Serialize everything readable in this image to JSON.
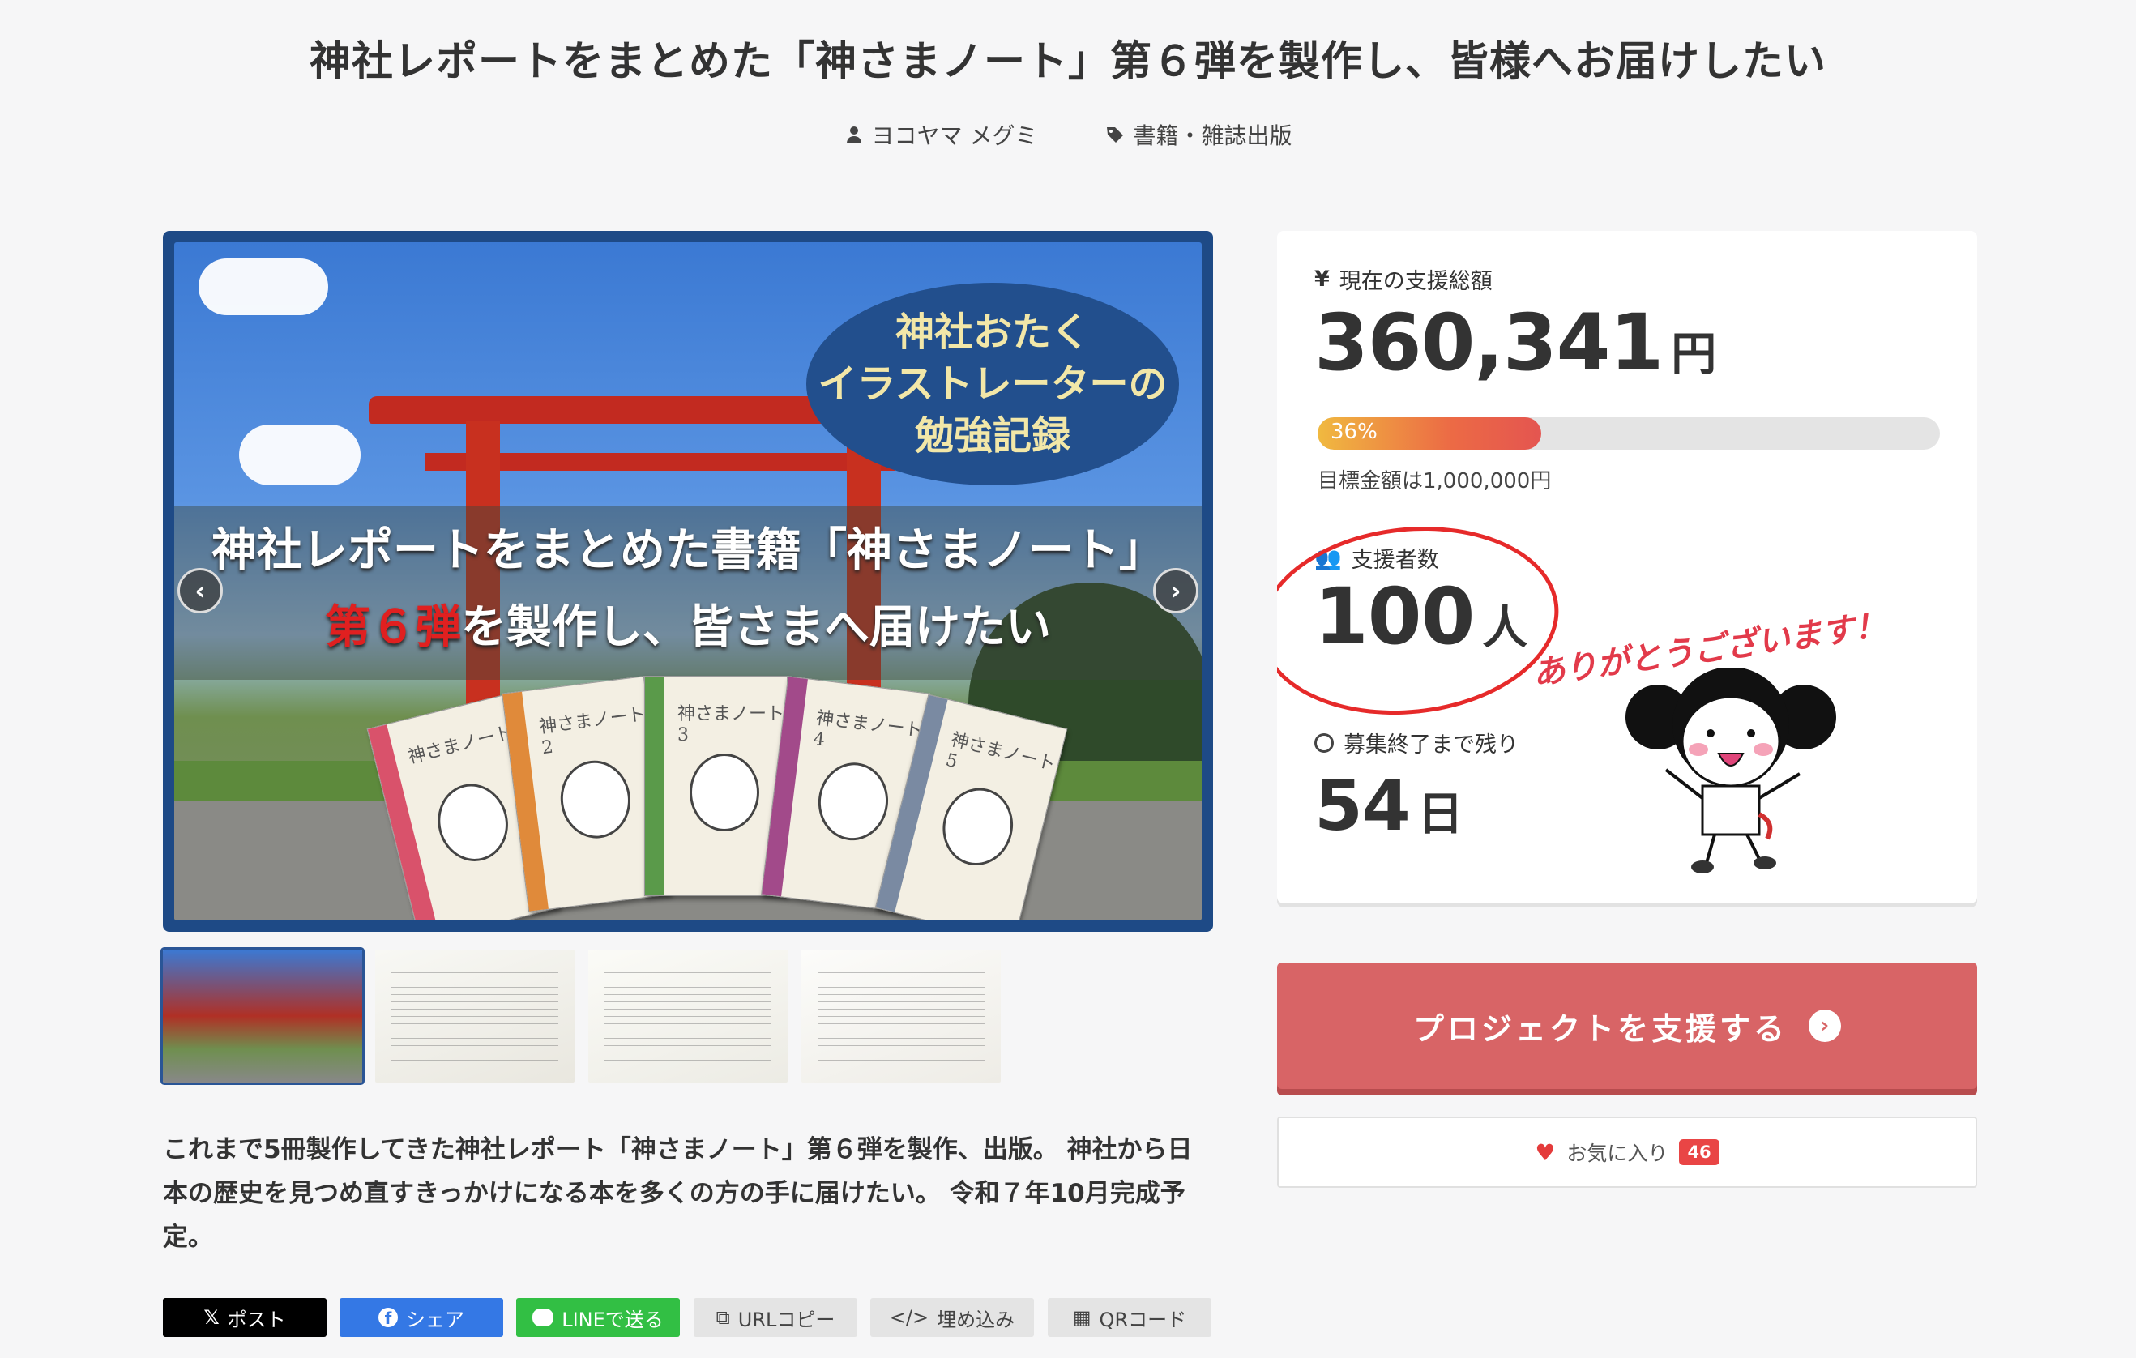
{
  "page": {
    "title": "神社レポートをまとめた「神さまノート」第６弾を製作し、皆様へお届けしたい",
    "author": "ヨコヤマ メグミ",
    "category": "書籍・雑誌出版"
  },
  "hero": {
    "oval_line1": "神社おたく",
    "oval_line2": "イラストレーターの",
    "oval_line3": "勉強記録",
    "line1": "神社レポートをまとめた書籍「神さまノート」",
    "line2_red": "第６弾",
    "line2_rest": "を製作し、皆さまへ届けたい",
    "books": [
      "神さまノート",
      "神さまノート2",
      "神さまノート3",
      "神さまノート4",
      "神さまノート5"
    ],
    "prev_icon": "chevron-left-icon",
    "next_icon": "chevron-right-icon"
  },
  "thumbnails": {
    "count": 4,
    "active_index": 0
  },
  "description": "これまで5冊製作してきた神社レポート「神さまノート」第６弾を製作、出版。 神社から日本の歴史を見つめ直すきっかけになる本を多くの方の手に届けたい。 令和７年10月完成予定。",
  "share": {
    "x": "ポスト",
    "facebook": "シェア",
    "line": "LINEで送る",
    "url_copy": "URLコピー",
    "embed": "埋め込み",
    "qr": "QRコード"
  },
  "stats": {
    "total_label": "現在の支援総額",
    "total_value": "360,341",
    "total_unit": "円",
    "progress_percent": 36,
    "progress_label": "36%",
    "goal_text": "目標金額は1,000,000円",
    "supporters_label": "支援者数",
    "supporters_value": "100",
    "supporters_unit": "人",
    "remaining_label": "募集終了まで残り",
    "remaining_value": "54",
    "remaining_unit": "日",
    "thanks_text": "ありがとうございます！"
  },
  "actions": {
    "support_label": "プロジェクトを支援する",
    "favorite_label": "お気に入り",
    "favorite_count": "46"
  },
  "colors": {
    "support_button": "#d86466",
    "hero_frame": "#1e4a86",
    "progress_start": "#f0b940",
    "progress_end": "#e45550",
    "favorite_badge": "#e94545"
  }
}
